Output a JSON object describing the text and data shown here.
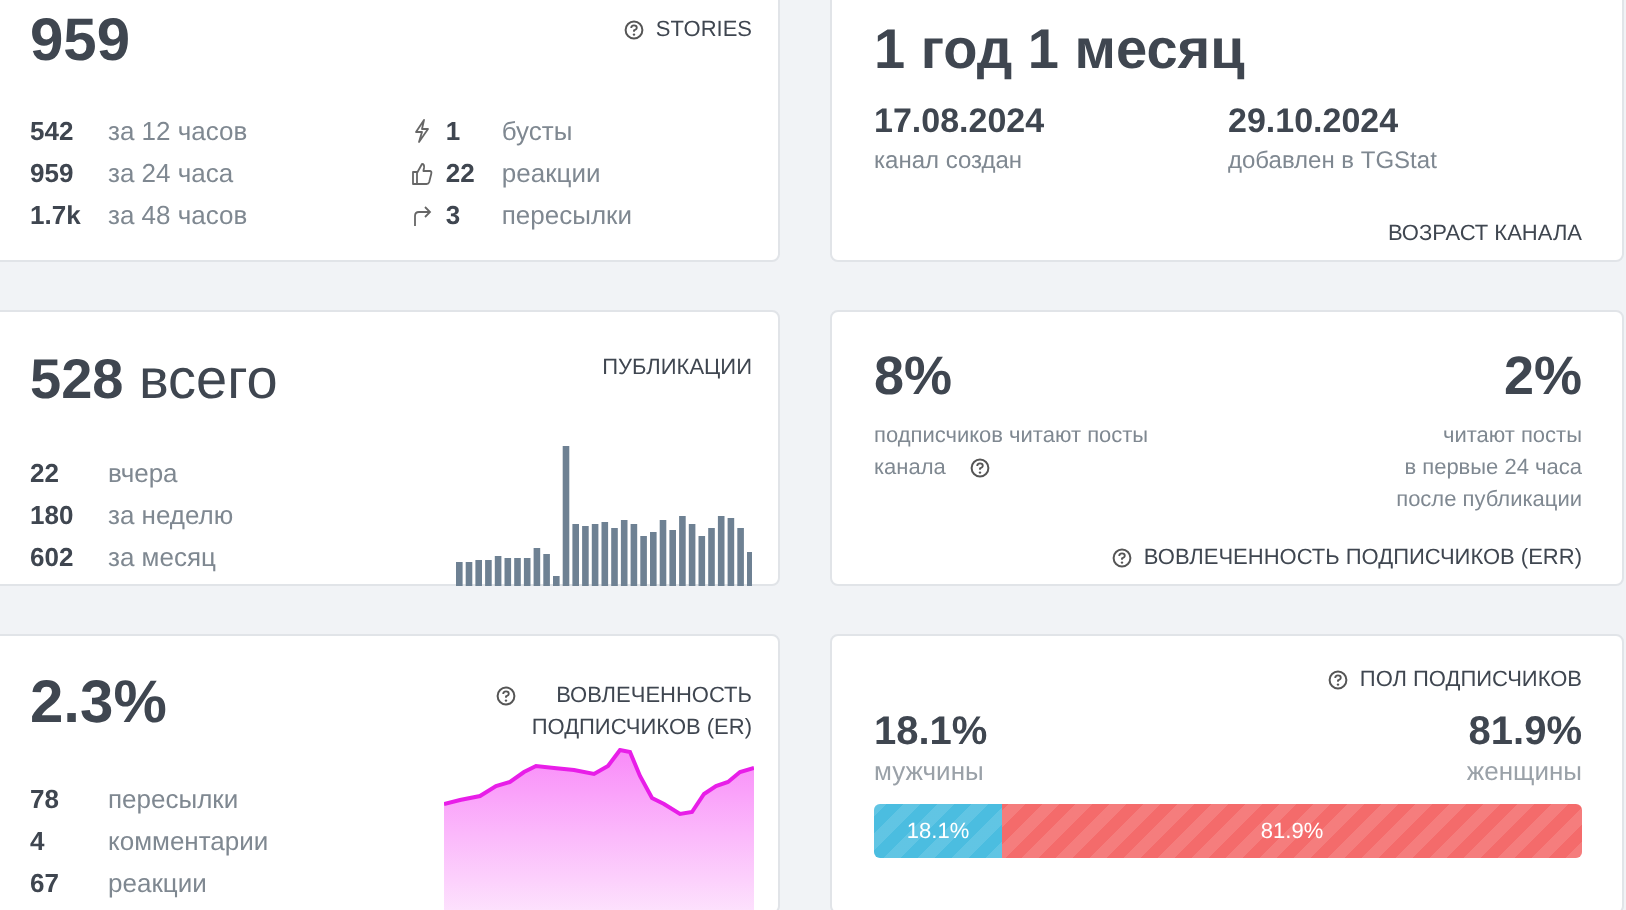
{
  "stories": {
    "title": "STORIES",
    "total": "959",
    "periods": [
      {
        "value": "542",
        "label": "за 12 часов"
      },
      {
        "value": "959",
        "label": "за 24 часа"
      },
      {
        "value": "1.7k",
        "label": "за 48 часов"
      }
    ],
    "actions": [
      {
        "kind": "boost",
        "value": "1",
        "label": "бусты"
      },
      {
        "kind": "reaction",
        "value": "22",
        "label": "реакции"
      },
      {
        "kind": "forward",
        "value": "3",
        "label": "пересылки"
      }
    ]
  },
  "channel_age": {
    "title": "ВОЗРАСТ КАНАЛА",
    "age": "1 год 1 месяц",
    "dates": [
      {
        "date": "17.08.2024",
        "label": "канал создан"
      },
      {
        "date": "29.10.2024",
        "label": "добавлен в TGStat"
      }
    ]
  },
  "publications": {
    "title": "ПУБЛИКАЦИИ",
    "total": "**528** всего",
    "periods": [
      {
        "value": "22",
        "label": "вчера"
      },
      {
        "value": "180",
        "label": "за неделю"
      },
      {
        "value": "602",
        "label": "за месяц"
      }
    ]
  },
  "err": {
    "title": "ВОВЛЕЧЕННОСТЬ ПОДПИСЧИКОВ (ERR)",
    "left": {
      "value": "8%",
      "lines": [
        "подписчиков читают посты",
        "канала"
      ]
    },
    "right": {
      "value": "2%",
      "lines": [
        "читают посты",
        "в первые 24 часа",
        "после публикации"
      ]
    }
  },
  "er": {
    "title": "ВОВЛЕЧЕННОСТЬ ПОДПИСЧИКОВ (ER)",
    "value": "2.3%",
    "items": [
      {
        "value": "78",
        "label": "пересылки"
      },
      {
        "value": "4",
        "label": "комментарии"
      },
      {
        "value": "67",
        "label": "реакции"
      }
    ]
  },
  "gender": {
    "title": "ПОЛ ПОДПИСЧИКОВ",
    "groups": [
      {
        "value": "18.1%",
        "label": "мужчины",
        "bar_label": "18.1%",
        "color": "#4bbde0",
        "level": 0.181
      },
      {
        "value": "81.9%",
        "label": "женщины",
        "bar_label": "81.9%",
        "color": "#f46b6b"
      }
    ]
  }
}
